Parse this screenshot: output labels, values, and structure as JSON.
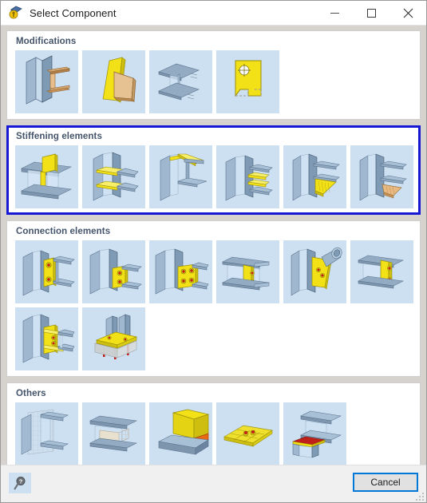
{
  "window": {
    "title": "Select Component",
    "app_icon": "component-icon",
    "buttons": {
      "minimize_label": "—",
      "minimize_name": "minimize-icon",
      "maximize_label": "□",
      "maximize_name": "maximize-icon",
      "close_label": "✕",
      "close_name": "close-icon"
    }
  },
  "colors": {
    "selection_border": "#1717d6",
    "tile_background": "#cde0f2",
    "group_title": "#44546a",
    "dialog_background": "#d6d3ce",
    "accent_button_border": "#0078d7",
    "steel_blue": "#8aa6c0",
    "highlight_yellow": "#f2e117",
    "tan": "#e8b980",
    "bolt_red": "#c0201a",
    "orange": "#e86a12"
  },
  "groups": [
    {
      "title": "Modifications",
      "selected": false,
      "tiles": [
        {
          "name": "tile-modification-beam-cut-to-column",
          "art": "beam-into-column-web"
        },
        {
          "name": "tile-modification-skewed-plate",
          "art": "two-skewed-plates"
        },
        {
          "name": "tile-modification-beam-notch",
          "art": "beam-notch-dimensions"
        },
        {
          "name": "tile-modification-plate-contour",
          "art": "yellow-plate-with-hole"
        }
      ]
    },
    {
      "title": "Stiffening elements",
      "selected": true,
      "tiles": [
        {
          "name": "tile-stiffener-vertical-web-plate",
          "art": "beam-vertical-stiffener"
        },
        {
          "name": "tile-stiffener-horizontal-column-plates",
          "art": "column-horizontal-stiffeners"
        },
        {
          "name": "tile-stiffener-top-flange-plate",
          "art": "beam-top-flange-plate"
        },
        {
          "name": "tile-stiffener-column-web-plates",
          "art": "column-web-double-stiffener"
        },
        {
          "name": "tile-stiffener-haunch-yellow",
          "art": "beam-haunch-yellow"
        },
        {
          "name": "tile-stiffener-haunch-tan",
          "art": "beam-haunch-tan"
        }
      ]
    },
    {
      "title": "Connection elements",
      "selected": false,
      "tiles": [
        {
          "name": "tile-connection-end-plate-2-bolts",
          "art": "endplate-two-bolts"
        },
        {
          "name": "tile-connection-fin-plate-2-bolts",
          "art": "finplate-two-bolts"
        },
        {
          "name": "tile-connection-fin-plate-4-bolts",
          "art": "finplate-four-bolts"
        },
        {
          "name": "tile-connection-double-beam-web-plate",
          "art": "double-beam-web-plate"
        },
        {
          "name": "tile-connection-tube-gusset",
          "art": "tube-gusset-plate"
        },
        {
          "name": "tile-connection-column-web-angle",
          "art": "column-web-angle"
        },
        {
          "name": "tile-connection-moment-endplate",
          "art": "moment-endplate"
        },
        {
          "name": "tile-connection-base-plate-anchors",
          "art": "base-plate-anchors"
        }
      ]
    },
    {
      "title": "Others",
      "selected": false,
      "tiles": [
        {
          "name": "tile-other-mesh-surface",
          "art": "mesh-surface-beam"
        },
        {
          "name": "tile-other-mesh-volume",
          "art": "mesh-volume-beam"
        },
        {
          "name": "tile-other-weld-seam",
          "art": "weld-seam"
        },
        {
          "name": "tile-other-plate-with-bolts",
          "art": "flat-plate-bolts"
        },
        {
          "name": "tile-other-concrete-support",
          "art": "concrete-support"
        }
      ]
    }
  ],
  "footer": {
    "help_icon": "help-magnifier-icon",
    "cancel_label": "Cancel",
    "resize_grip": "resize-grip-icon"
  }
}
